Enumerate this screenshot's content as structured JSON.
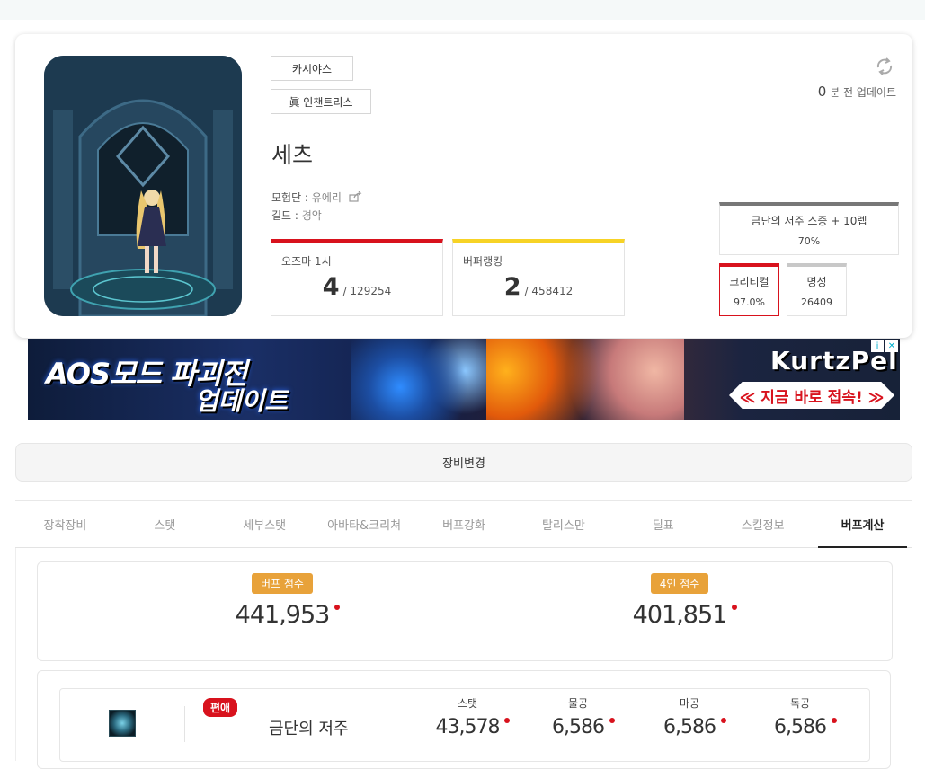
{
  "character": {
    "server": "카시야스",
    "job": "眞 인챈트리스",
    "name": "세츠",
    "adventure_label": "모험단 : ",
    "adventure_value": "유에리",
    "guild_label": "길드 : ",
    "guild_value": "경악"
  },
  "update": {
    "count": "0",
    "text": " 분 전 업데이트"
  },
  "rankings": [
    {
      "label": "오즈마 1시",
      "rank": "4",
      "total": "/ 129254",
      "color": "#d8121d"
    },
    {
      "label": "버퍼랭킹",
      "rank": "2",
      "total": "/ 458412",
      "color": "#f7d326"
    }
  ],
  "curse": {
    "label": "금단의 저주 스증 + 10렙",
    "value": "70%"
  },
  "critical": {
    "label": "크리티컬",
    "value": "97.0%"
  },
  "fame": {
    "label": "명성",
    "value": "26409"
  },
  "ad": {
    "title_line1": "AOS모드 파괴전",
    "title_line2": "업데이트",
    "brand": "KurtzPel",
    "cta": "≪ 지금 바로 접속! ≫",
    "info_icon": "i",
    "close_icon": "✕"
  },
  "equip_change": "장비변경",
  "tabs": [
    "장착장비",
    "스탯",
    "세부스탯",
    "아바타&크리쳐",
    "버프강화",
    "탈리스만",
    "딜표",
    "스킬정보",
    "버프계산"
  ],
  "active_tab": "버프계산",
  "scores": {
    "buff_label": "버프 점수",
    "buff_value": "441,953",
    "four_label": "4인 점수",
    "four_value": "401,851"
  },
  "buff_row": {
    "badge": "편애",
    "name": "금단의 저주",
    "stats": [
      {
        "label": "스탯",
        "value": "43,578"
      },
      {
        "label": "물공",
        "value": "6,586"
      },
      {
        "label": "마공",
        "value": "6,586"
      },
      {
        "label": "독공",
        "value": "6,586"
      }
    ]
  },
  "colors": {
    "accent_red": "#d8121d",
    "accent_yellow": "#f7d326",
    "badge_orange": "#e8a23a"
  }
}
